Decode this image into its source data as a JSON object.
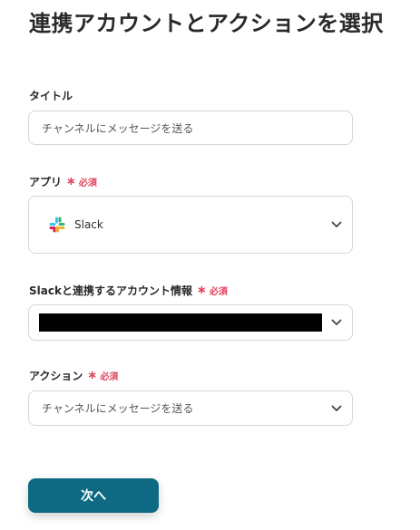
{
  "page_title": "連携アカウントとアクションを選択",
  "title_field": {
    "label": "タイトル",
    "value": "チャンネルにメッセージを送る"
  },
  "app_field": {
    "label": "アプリ",
    "required_mark": "∗",
    "required_text": "必須",
    "value": "Slack",
    "icon": "slack-logo"
  },
  "account_field": {
    "label": "Slackと連携するアカウント情報",
    "required_mark": "∗",
    "required_text": "必須",
    "value_redacted": true
  },
  "action_field": {
    "label": "アクション",
    "required_mark": "∗",
    "required_text": "必須",
    "value": "チャンネルにメッセージを送る"
  },
  "next_button": {
    "label": "次へ"
  },
  "colors": {
    "primary_button": "#0e6a82",
    "required": "#e2445c",
    "border": "#d6d6d6"
  }
}
